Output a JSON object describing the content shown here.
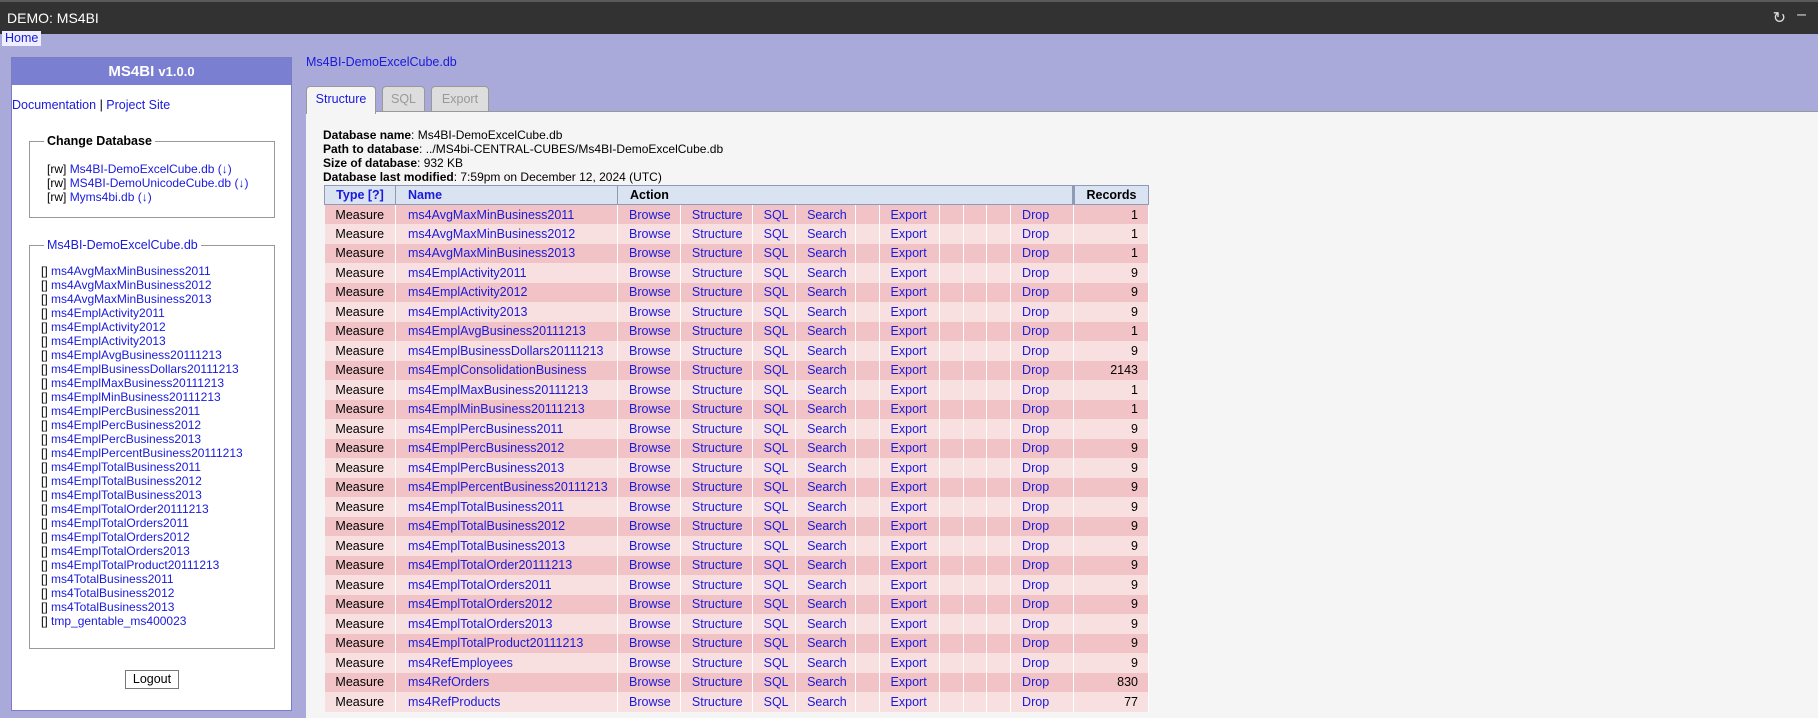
{
  "window": {
    "title": "DEMO: MS4BI"
  },
  "nav": {
    "home": "Home"
  },
  "sidebar": {
    "app_name": "MS4BI",
    "version": "v1.0.0",
    "documentation": "Documentation",
    "separator": "|",
    "project_site": "Project Site",
    "change_db_legend": "Change Database",
    "databases": [
      {
        "mode": "[rw]",
        "name": "Ms4BI-DemoExcelCube.db",
        "arrow": "(↓)"
      },
      {
        "mode": "[rw]",
        "name": "MS4BI-DemoUnicodeCube.db",
        "arrow": "(↓)"
      },
      {
        "mode": "[rw]",
        "name": "Myms4bi.db",
        "arrow": "(↓)"
      }
    ],
    "tables_legend": "Ms4BI-DemoExcelCube.db",
    "table_bracket": "[]",
    "logout": "Logout"
  },
  "main": {
    "db_link": "Ms4BI-DemoExcelCube.db",
    "tabs": [
      "Structure",
      "SQL",
      "Export"
    ],
    "info": {
      "name_label": "Database name",
      "name_value": ": Ms4BI-DemoExcelCube.db",
      "path_label": "Path to database",
      "path_value": ": ../MS4bi-CENTRAL-CUBES/Ms4BI-DemoExcelCube.db",
      "size_label": "Size of database",
      "size_value": ": 932 KB",
      "modified_label": "Database last modified",
      "modified_value": ": 7:59pm on December 12, 2024 (UTC)"
    },
    "headers": {
      "type": "Type [?]",
      "name": "Name",
      "action": "Action",
      "records": "Records"
    },
    "actions": [
      "Browse",
      "Structure",
      "SQL",
      "Search",
      "",
      "Export",
      "",
      "",
      "",
      "Drop"
    ],
    "rows": [
      {
        "type": "Measure",
        "name": "ms4AvgMaxMinBusiness2011",
        "records": "1"
      },
      {
        "type": "Measure",
        "name": "ms4AvgMaxMinBusiness2012",
        "records": "1"
      },
      {
        "type": "Measure",
        "name": "ms4AvgMaxMinBusiness2013",
        "records": "1"
      },
      {
        "type": "Measure",
        "name": "ms4EmplActivity2011",
        "records": "9"
      },
      {
        "type": "Measure",
        "name": "ms4EmplActivity2012",
        "records": "9"
      },
      {
        "type": "Measure",
        "name": "ms4EmplActivity2013",
        "records": "9"
      },
      {
        "type": "Measure",
        "name": "ms4EmplAvgBusiness20111213",
        "records": "1"
      },
      {
        "type": "Measure",
        "name": "ms4EmplBusinessDollars20111213",
        "records": "9"
      },
      {
        "type": "Measure",
        "name": "ms4EmplConsolidationBusiness",
        "records": "2143"
      },
      {
        "type": "Measure",
        "name": "ms4EmplMaxBusiness20111213",
        "records": "1"
      },
      {
        "type": "Measure",
        "name": "ms4EmplMinBusiness20111213",
        "records": "1"
      },
      {
        "type": "Measure",
        "name": "ms4EmplPercBusiness2011",
        "records": "9"
      },
      {
        "type": "Measure",
        "name": "ms4EmplPercBusiness2012",
        "records": "9"
      },
      {
        "type": "Measure",
        "name": "ms4EmplPercBusiness2013",
        "records": "9"
      },
      {
        "type": "Measure",
        "name": "ms4EmplPercentBusiness20111213",
        "records": "9"
      },
      {
        "type": "Measure",
        "name": "ms4EmplTotalBusiness2011",
        "records": "9"
      },
      {
        "type": "Measure",
        "name": "ms4EmplTotalBusiness2012",
        "records": "9"
      },
      {
        "type": "Measure",
        "name": "ms4EmplTotalBusiness2013",
        "records": "9"
      },
      {
        "type": "Measure",
        "name": "ms4EmplTotalOrder20111213",
        "records": "9"
      },
      {
        "type": "Measure",
        "name": "ms4EmplTotalOrders2011",
        "records": "9"
      },
      {
        "type": "Measure",
        "name": "ms4EmplTotalOrders2012",
        "records": "9"
      },
      {
        "type": "Measure",
        "name": "ms4EmplTotalOrders2013",
        "records": "9"
      },
      {
        "type": "Measure",
        "name": "ms4EmplTotalProduct20111213",
        "records": "9"
      },
      {
        "type": "Measure",
        "name": "ms4RefEmployees",
        "records": "9"
      },
      {
        "type": "Measure",
        "name": "ms4RefOrders",
        "records": "830"
      },
      {
        "type": "Measure",
        "name": "ms4RefProducts",
        "records": "77"
      }
    ],
    "sidebar_tables": [
      "ms4AvgMaxMinBusiness2011",
      "ms4AvgMaxMinBusiness2012",
      "ms4AvgMaxMinBusiness2013",
      "ms4EmplActivity2011",
      "ms4EmplActivity2012",
      "ms4EmplActivity2013",
      "ms4EmplAvgBusiness20111213",
      "ms4EmplBusinessDollars20111213",
      "ms4EmplMaxBusiness20111213",
      "ms4EmplMinBusiness20111213",
      "ms4EmplPercBusiness2011",
      "ms4EmplPercBusiness2012",
      "ms4EmplPercBusiness2013",
      "ms4EmplPercentBusiness20111213",
      "ms4EmplTotalBusiness2011",
      "ms4EmplTotalBusiness2012",
      "ms4EmplTotalBusiness2013",
      "ms4EmplTotalOrder20111213",
      "ms4EmplTotalOrders2011",
      "ms4EmplTotalOrders2012",
      "ms4EmplTotalOrders2013",
      "ms4EmplTotalProduct20111213",
      "ms4TotalBusiness2011",
      "ms4TotalBusiness2012",
      "ms4TotalBusiness2013",
      "tmp_gentable_ms400023"
    ]
  }
}
